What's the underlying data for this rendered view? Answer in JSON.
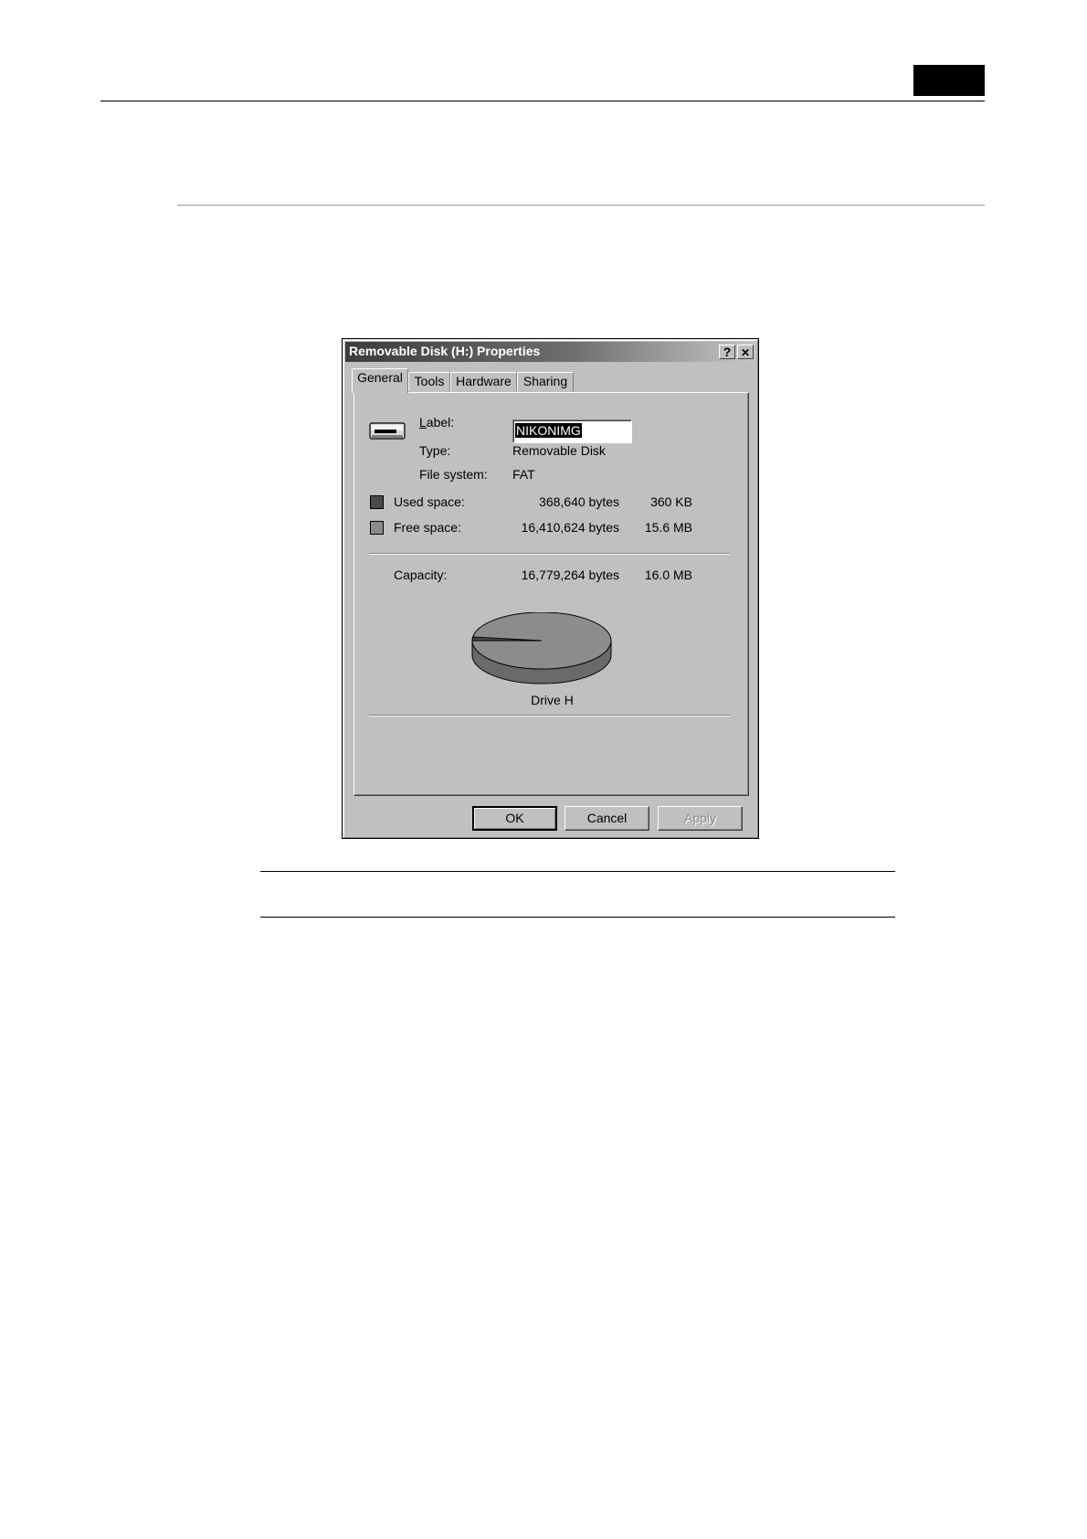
{
  "dialog": {
    "title": "Removable Disk (H:) Properties",
    "help_label": "?",
    "close_label": "✕",
    "tabs": [
      {
        "label": "General",
        "active": true
      },
      {
        "label": "Tools",
        "active": false
      },
      {
        "label": "Hardware",
        "active": false
      },
      {
        "label": "Sharing",
        "active": false
      }
    ],
    "general": {
      "label_caption": "Label:",
      "label_value": "NIKONIMG",
      "type_caption": "Type:",
      "type_value": "Removable Disk",
      "fs_caption": "File system:",
      "fs_value": "FAT",
      "used_caption": "Used space:",
      "used_bytes": "368,640 bytes",
      "used_size": "360 KB",
      "free_caption": "Free space:",
      "free_bytes": "16,410,624 bytes",
      "free_size": "15.6 MB",
      "capacity_caption": "Capacity:",
      "capacity_bytes": "16,779,264 bytes",
      "capacity_size": "16.0 MB",
      "drive_caption": "Drive H",
      "used_color": "#4a4a4a",
      "free_color": "#8c8c8c"
    },
    "buttons": {
      "ok": "OK",
      "cancel": "Cancel",
      "apply": "Apply"
    },
    "icons": {
      "drive": "removable-drive-icon"
    }
  }
}
